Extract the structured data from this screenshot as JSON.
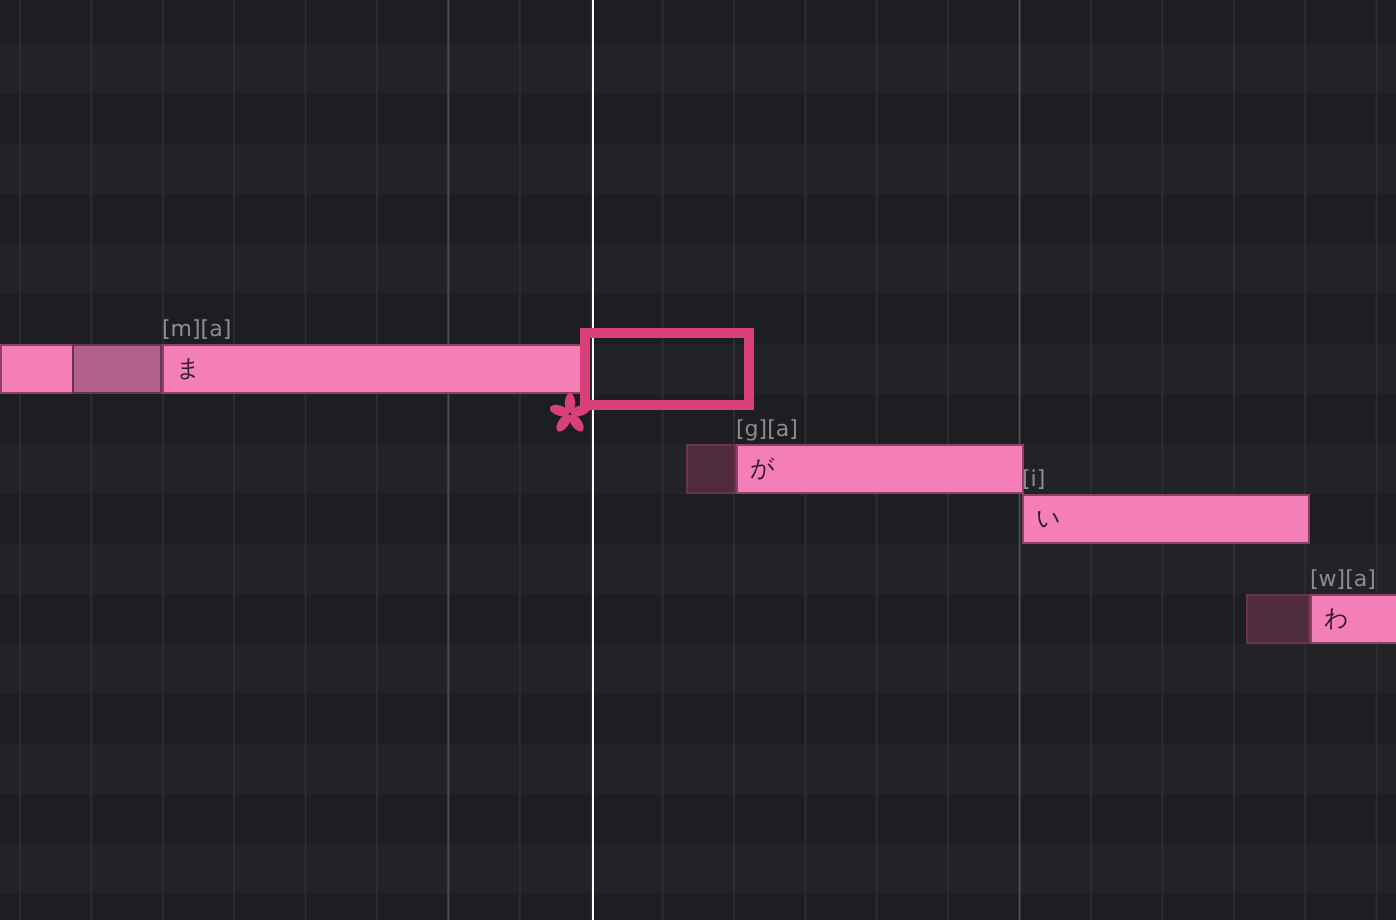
{
  "piano_roll": {
    "notes": [
      {
        "kind": "tail"
      },
      {
        "kind": "note",
        "phonemes": "[m][a]",
        "lyric": "ま"
      },
      {
        "kind": "note",
        "phonemes": "[g][a]",
        "lyric": "が"
      },
      {
        "kind": "note",
        "phonemes": "[i]",
        "lyric": "い"
      },
      {
        "kind": "note",
        "phonemes": "[w][a]",
        "lyric": "わ"
      }
    ]
  }
}
